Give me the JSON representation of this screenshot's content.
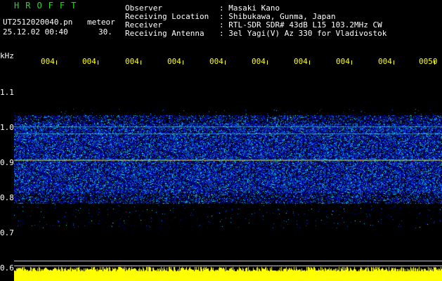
{
  "header": {
    "program": "HROFFT",
    "filename": "UT2512020040.pn",
    "mode": "meteor",
    "datetime": "25.12.02 00:40",
    "count": "30.",
    "fields": [
      {
        "label": "Observer",
        "value": ": Masaki Kano"
      },
      {
        "label": "Receiving Location",
        "value": ": Shibukawa, Gunma, Japan"
      },
      {
        "label": "Receiver",
        "value": ": RTL-SDR SDR# 43dB L15 103.2MHz CW"
      },
      {
        "label": "Receiving Antenna",
        "value": ": 3el Yagi(V) Az 330 for Vladivostok"
      }
    ]
  },
  "axis": {
    "unit": "kHz",
    "y_ticks": [
      "1.1",
      "1.0",
      "0.9",
      "0.8",
      "0.7",
      "0.6"
    ],
    "x_ticks": [
      "004",
      "004",
      "004",
      "004",
      "004",
      "004",
      "004",
      "004",
      "004",
      "0050"
    ]
  },
  "colors": {
    "background": "#000000",
    "text_yellow": "#ffff00",
    "text_green": "#22dd22",
    "level_bars": "#ffff00"
  }
}
